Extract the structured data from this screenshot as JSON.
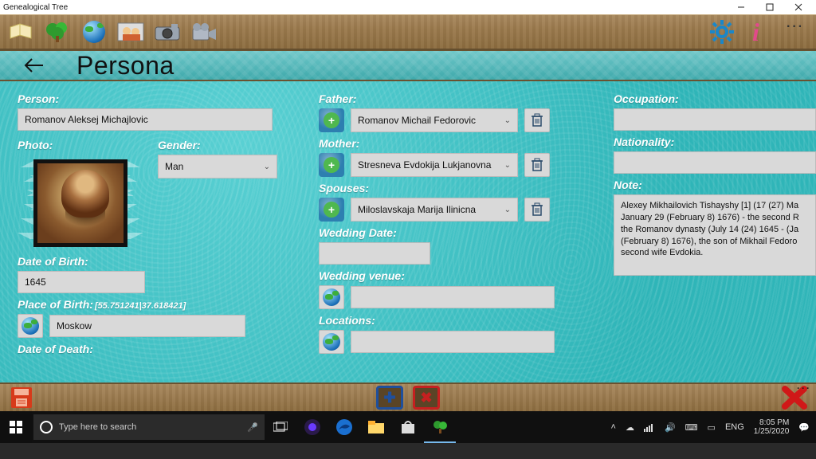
{
  "window": {
    "title": "Genealogical Tree"
  },
  "header": {
    "page_title": "Persona"
  },
  "col1": {
    "person_lbl": "Person:",
    "person_val": "Romanov Aleksej Michajlovic",
    "photo_lbl": "Photo:",
    "gender_lbl": "Gender:",
    "gender_val": "Man",
    "dob_lbl": "Date of Birth:",
    "dob_val": "1645",
    "pob_lbl": "Place of Birth:",
    "pob_coords": "[55.751241|37.618421]",
    "pob_val": "Moskow",
    "dod_lbl": "Date of Death:"
  },
  "col2": {
    "father_lbl": "Father:",
    "father_val": "Romanov Michail Fedorovic",
    "mother_lbl": "Mother:",
    "mother_val": "Stresneva Evdokija Lukjanovna",
    "spouses_lbl": "Spouses:",
    "spouse_val": "Miloslavskaja Marija Ilinicna",
    "wedding_date_lbl": "Wedding Date:",
    "wedding_date_val": "",
    "wedding_venue_lbl": "Wedding venue:",
    "wedding_venue_val": "",
    "locations_lbl": "Locations:",
    "locations_val": ""
  },
  "col3": {
    "occupation_lbl": "Occupation:",
    "occupation_val": "",
    "nationality_lbl": "Nationality:",
    "nationality_val": "",
    "note_lbl": "Note:",
    "note_val": "Alexey Mikhailovich Tishayshy [1] (17 (27) Ma January 29 (February 8) 1676) - the second R the Romanov dynasty (July 14 (24) 1645 - (Ja (February 8) 1676), the son of Mikhail Fedoro second wife Evdokia."
  },
  "taskbar": {
    "search_placeholder": "Type here to search",
    "lang": "ENG",
    "time": "8:05 PM",
    "date": "1/25/2020"
  }
}
